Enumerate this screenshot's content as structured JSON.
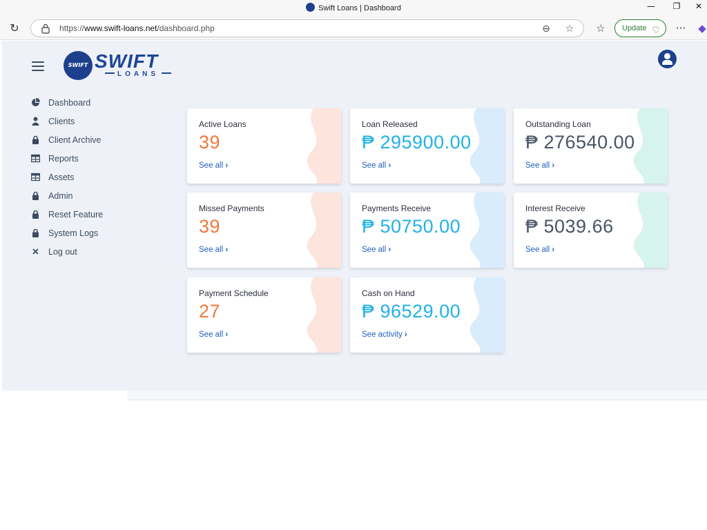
{
  "browser": {
    "window_title": "Swift Loans | Dashboard",
    "url_prefix": "https://",
    "url_host": "www.swift-loans.net",
    "url_path": "/dashboard.php",
    "update_label": "Update"
  },
  "brand": {
    "badge_text": "SWIFT",
    "word": "SWIFT",
    "sub": "LOANS",
    "color": "#1f4596"
  },
  "sidebar": {
    "items": [
      {
        "label": "Dashboard",
        "icon": "pie-chart-icon"
      },
      {
        "label": "Clients",
        "icon": "user-icon"
      },
      {
        "label": "Client Archive",
        "icon": "lock-icon"
      },
      {
        "label": "Reports",
        "icon": "table-icon"
      },
      {
        "label": "Assets",
        "icon": "table-icon"
      },
      {
        "label": "Admin",
        "icon": "lock-icon"
      },
      {
        "label": "Reset Feature",
        "icon": "lock-icon"
      },
      {
        "label": "System Logs",
        "icon": "lock-icon"
      },
      {
        "label": "Log out",
        "icon": "close-icon"
      }
    ]
  },
  "cards": [
    {
      "title": "Active Loans",
      "value": "39",
      "link": "See all",
      "color": "#f07a3c",
      "wave": "#fde4dc"
    },
    {
      "title": "Loan Released",
      "value": "₱ 295900.00",
      "link": "See all",
      "color": "#21b1e6",
      "wave": "#d8ecfb"
    },
    {
      "title": "Outstanding Loan",
      "value": "₱ 276540.00",
      "link": "See all",
      "color": "#4a5466",
      "wave": "#d7f3ee"
    },
    {
      "title": "Missed Payments",
      "value": "39",
      "link": "See all",
      "color": "#f07a3c",
      "wave": "#fde4dc"
    },
    {
      "title": "Payments Receive",
      "value": "₱ 50750.00",
      "link": "See all",
      "color": "#21b1e6",
      "wave": "#d8ecfb"
    },
    {
      "title": "Interest Receive",
      "value": "₱ 5039.66",
      "link": "See all",
      "color": "#4a5466",
      "wave": "#d7f3ee"
    },
    {
      "title": "Payment Schedule",
      "value": "27",
      "link": "See all",
      "color": "#f07a3c",
      "wave": "#fde4dc"
    },
    {
      "title": "Cash on Hand",
      "value": "₱ 96529.00",
      "link": "See activity",
      "color": "#21b1e6",
      "wave": "#d8ecfb"
    }
  ]
}
